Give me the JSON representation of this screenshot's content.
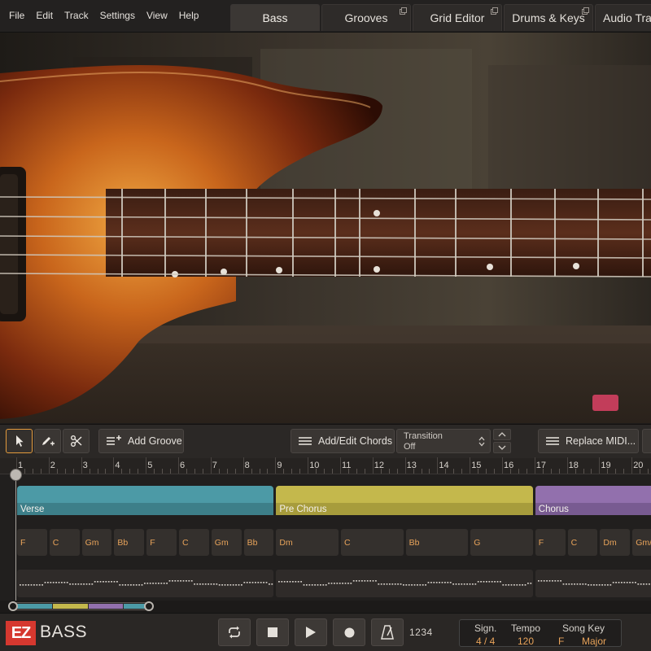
{
  "menu": [
    "File",
    "Edit",
    "Track",
    "Settings",
    "View",
    "Help"
  ],
  "tabs": [
    {
      "label": "Bass",
      "active": true,
      "popout": false
    },
    {
      "label": "Grooves",
      "active": false,
      "popout": true
    },
    {
      "label": "Grid Editor",
      "active": false,
      "popout": true
    },
    {
      "label": "Drums & Keys",
      "active": false,
      "popout": true
    },
    {
      "label": "Audio Tra",
      "active": false,
      "popout": false
    }
  ],
  "toolbar": {
    "tools": [
      "pointer-tool",
      "pencil-tool",
      "scissors-tool"
    ],
    "add_groove_label": "Add Groove",
    "add_edit_chords_label": "Add/Edit Chords",
    "transition_label": "Transition",
    "transition_value": "Off",
    "replace_midi_label": "Replace MIDI..."
  },
  "ruler": {
    "bars": [
      "1",
      "2",
      "3",
      "4",
      "5",
      "6",
      "7",
      "8",
      "9",
      "10",
      "11",
      "12",
      "13",
      "14",
      "15",
      "16",
      "17",
      "18",
      "19",
      "20"
    ]
  },
  "parts": [
    {
      "name": "Verse",
      "color": "#4c9aa6",
      "dark": "#3d7f89"
    },
    {
      "name": "Pre Chorus",
      "color": "#c4b84c",
      "dark": "#a79c3c"
    },
    {
      "name": "Chorus",
      "color": "#9270ad",
      "dark": "#785b91"
    }
  ],
  "chords": [
    {
      "label": "F",
      "bar": 1
    },
    {
      "label": "C",
      "bar": 2
    },
    {
      "label": "Gm",
      "bar": 3
    },
    {
      "label": "Bb",
      "bar": 4
    },
    {
      "label": "F",
      "bar": 5
    },
    {
      "label": "C",
      "bar": 6
    },
    {
      "label": "Gm",
      "bar": 7
    },
    {
      "label": "Bb",
      "bar": 8
    },
    {
      "label": "Dm",
      "bar": 9
    },
    {
      "label": "C",
      "bar": 11
    },
    {
      "label": "Bb",
      "bar": 13
    },
    {
      "label": "G",
      "bar": 15
    },
    {
      "label": "F",
      "bar": 17
    },
    {
      "label": "C",
      "bar": 18
    },
    {
      "label": "Dm",
      "bar": 19
    },
    {
      "label": "Gm/...",
      "bar": 20
    }
  ],
  "transport": {
    "buttons": [
      "loop-button",
      "stop-button",
      "play-button",
      "record-button",
      "metronome-button"
    ],
    "count_in": "1234"
  },
  "brand": {
    "logo": "EZ",
    "product": "BASS",
    "logo_color": "#d6382f"
  },
  "song_info": {
    "sign_label": "Sign.",
    "sign_value": "4 / 4",
    "tempo_label": "Tempo",
    "tempo_value": "120",
    "key_label": "Song Key",
    "key_root": "F",
    "key_mode": "Major"
  },
  "accent_color": "#e39a3c"
}
